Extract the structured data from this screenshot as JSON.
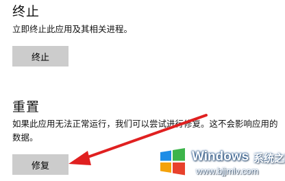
{
  "terminate": {
    "heading": "终止",
    "description": "立即终止此应用及其相关进程。",
    "button_label": "终止"
  },
  "reset": {
    "heading": "重置",
    "description": "如果此应用无法正常运行，我们可以尝试进行修复。这不会影响应用的数据。",
    "button_label": "修复"
  },
  "annotation": {
    "arrow_color": "#e02020",
    "target": "repair-button"
  },
  "watermark": {
    "brand": "Windows",
    "cn_text": "系统之家",
    "url": "www.bjjmlv.com"
  }
}
